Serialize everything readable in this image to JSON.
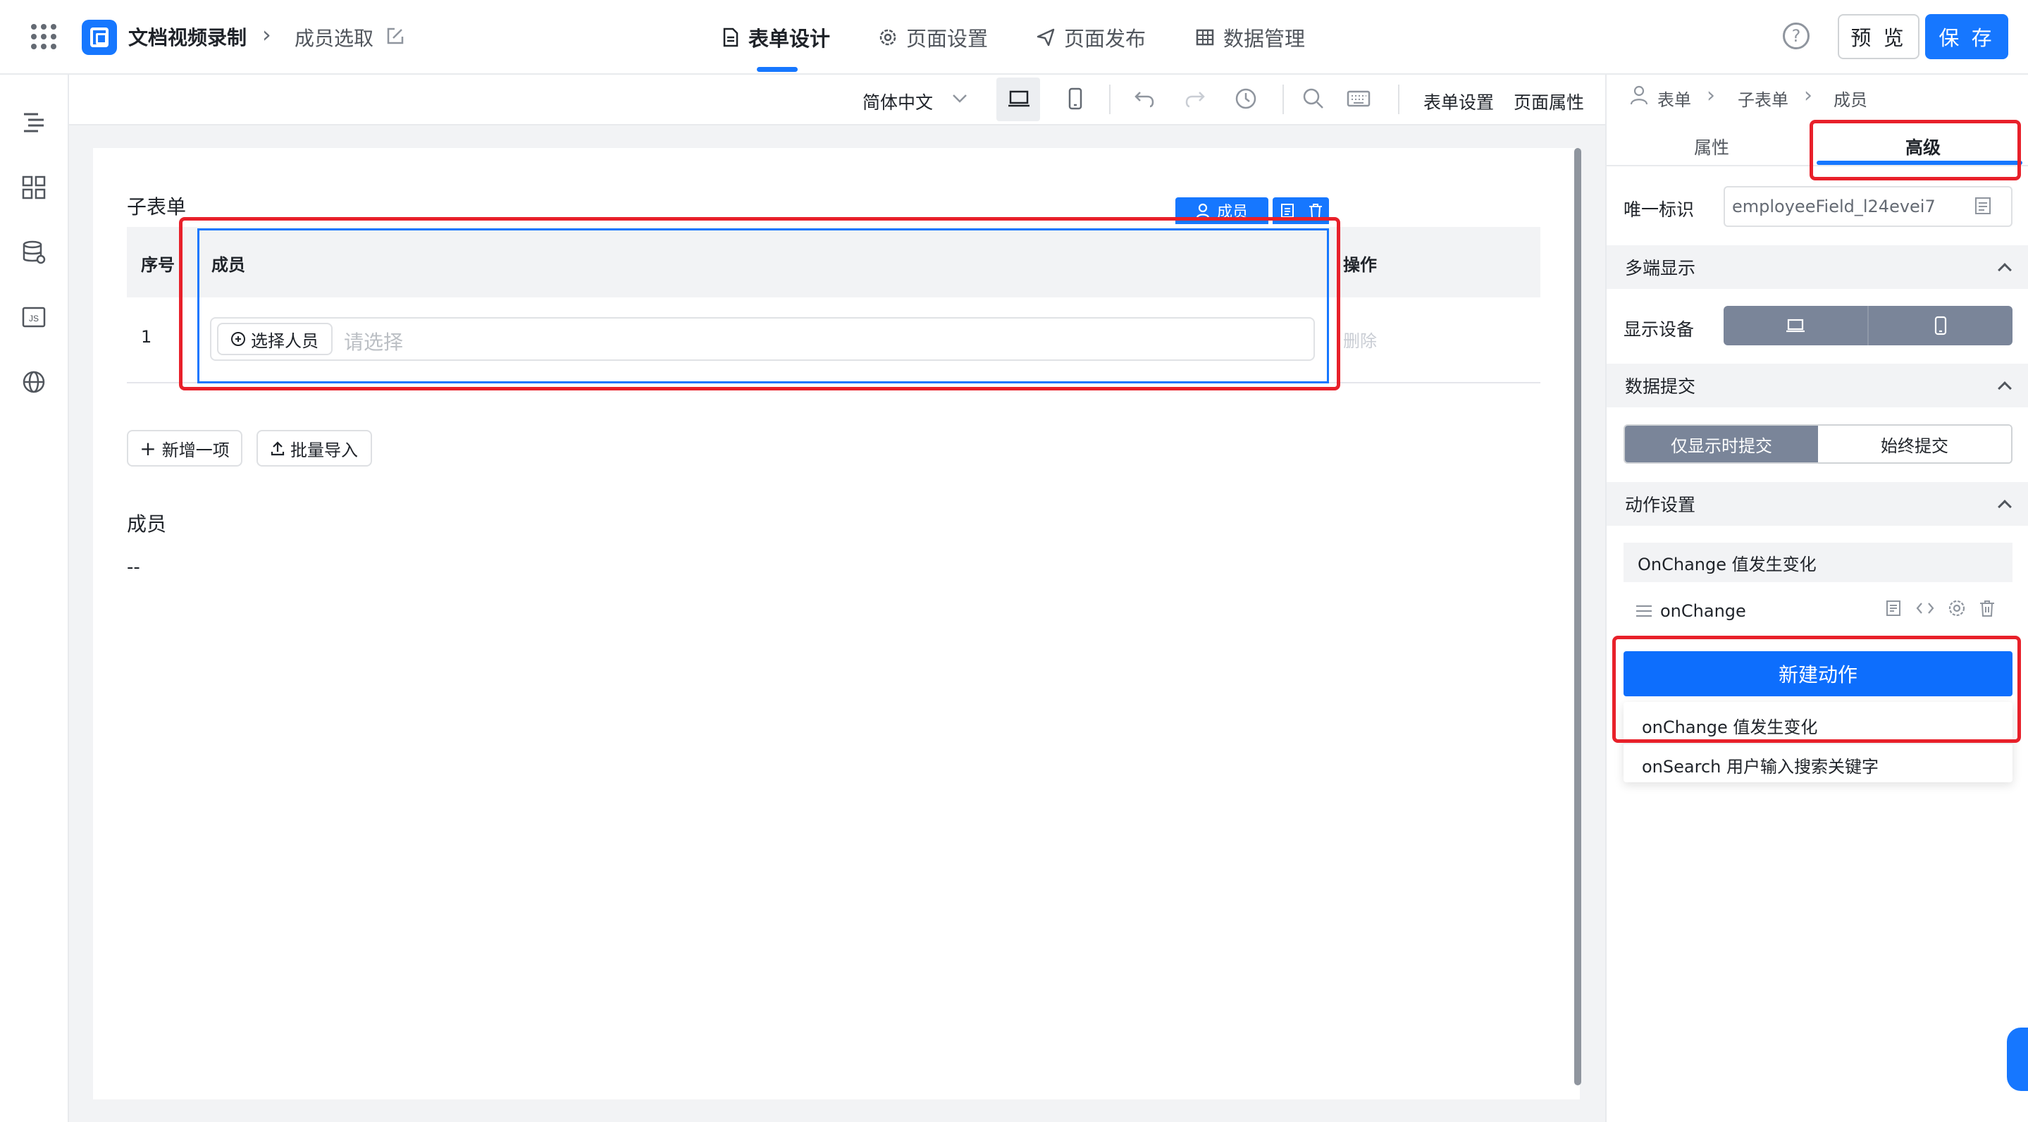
{
  "header": {
    "app_name": "文档视频录制",
    "page_name": "成员选取",
    "tabs": [
      {
        "label": "表单设计",
        "icon": "document-icon",
        "active": true
      },
      {
        "label": "页面设置",
        "icon": "gear-icon",
        "active": false
      },
      {
        "label": "页面发布",
        "icon": "send-icon",
        "active": false
      },
      {
        "label": "数据管理",
        "icon": "table-icon",
        "active": false
      }
    ],
    "help_icon": "?",
    "preview_label": "预 览",
    "save_label": "保 存",
    "accent_color": "#1677ff"
  },
  "sidebar": {
    "items": [
      {
        "icon": "outline-icon"
      },
      {
        "icon": "components-icon"
      },
      {
        "icon": "datasource-icon"
      },
      {
        "icon": "js-icon",
        "label": "JS"
      },
      {
        "icon": "globe-icon"
      }
    ]
  },
  "toolbar": {
    "language": "简体中文",
    "form_settings": "表单设置",
    "page_properties": "页面属性"
  },
  "canvas": {
    "subform_title": "子表单",
    "columns": [
      "序号",
      "成员",
      "操作"
    ],
    "rows": [
      {
        "index": "1",
        "select_button": "选择人员",
        "placeholder": "请选择",
        "action": "删除"
      }
    ],
    "selected_tag": "成员",
    "add_item": "新增一项",
    "batch_import": "批量导入",
    "member_label": "成员",
    "member_value": "--"
  },
  "right_panel": {
    "breadcrumb": [
      "表单",
      "子表单",
      "成员"
    ],
    "tabs": [
      {
        "label": "属性",
        "active": false
      },
      {
        "label": "高级",
        "active": true
      }
    ],
    "unique_id_label": "唯一标识",
    "unique_id_value": "employeeField_l24evei7",
    "sections": {
      "multi_display": "多端显示",
      "data_submit": "数据提交",
      "action_settings": "动作设置"
    },
    "display_device_label": "显示设备",
    "submit_options": [
      "仅显示时提交",
      "始终提交"
    ],
    "event_header": "OnChange 值发生变化",
    "handler_name": "onChange",
    "new_action_label": "新建动作",
    "dropdown_items": [
      "onChange 值发生变化",
      "onSearch 用户输入搜索关键字"
    ],
    "highlight_color": "#e8202a"
  }
}
